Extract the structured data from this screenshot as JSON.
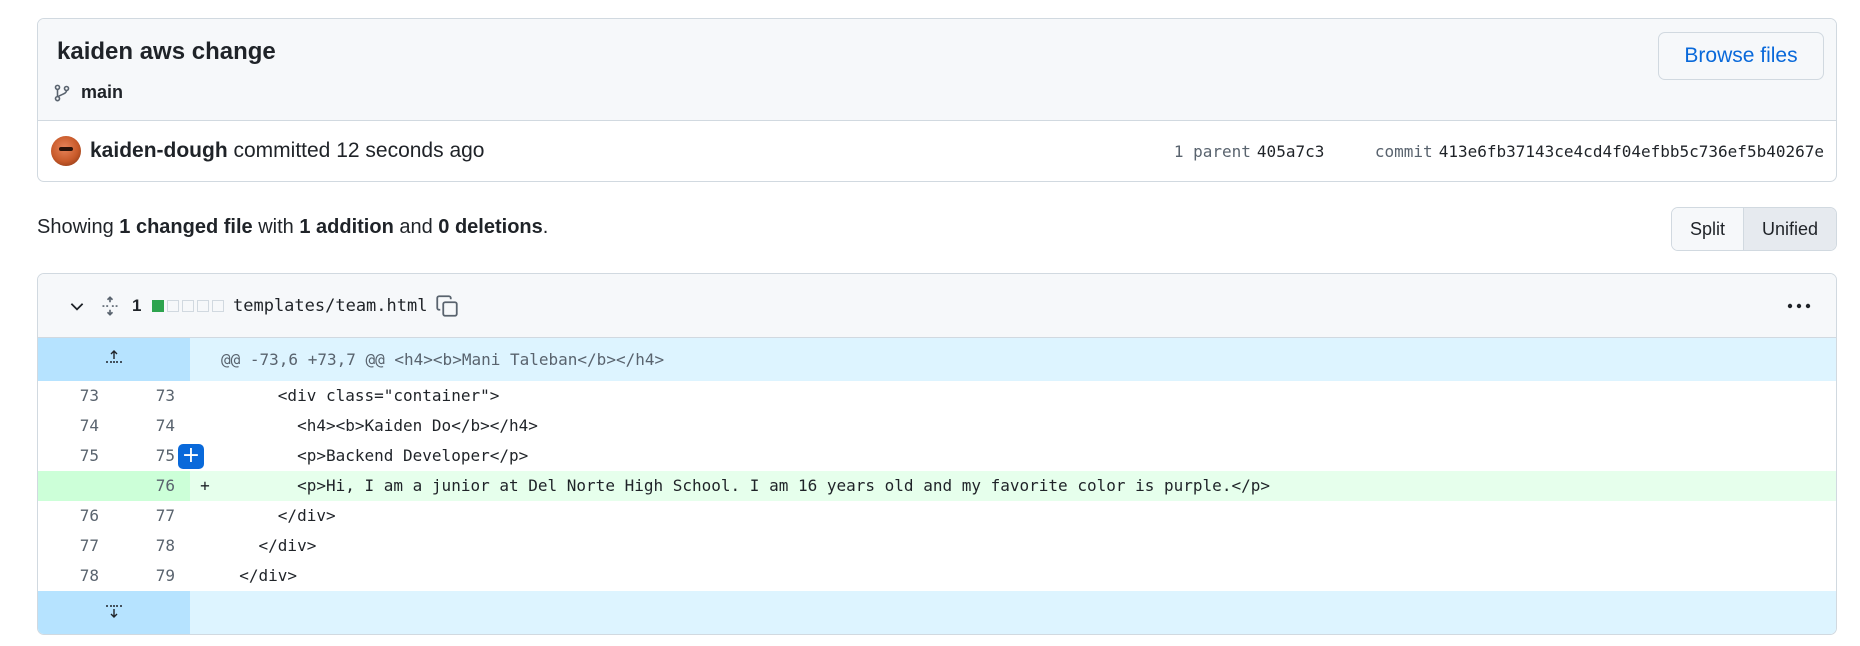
{
  "commit": {
    "title": "kaiden aws change",
    "branch": "main",
    "browse_files_label": "Browse files",
    "author": "kaiden-dough",
    "action": " committed 12 seconds ago",
    "parent_label": "1 parent",
    "parent_sha": "405a7c3",
    "commit_label": "commit",
    "commit_sha": "413e6fb37143ce4cd4f04efbb5c736ef5b40267e"
  },
  "summary": {
    "prefix": "Showing ",
    "changed": "1 changed file",
    "mid1": " with ",
    "additions": "1 addition",
    "mid2": " and ",
    "deletions": "0 deletions",
    "suffix": "."
  },
  "view_toggle": {
    "split": "Split",
    "unified": "Unified",
    "active": "unified"
  },
  "file": {
    "change_count": "1",
    "path": "templates/team.html",
    "diffstat": [
      "add",
      "neutral",
      "neutral",
      "neutral",
      "neutral"
    ],
    "hunk_header": "@@ -73,6 +73,7 @@ <h4><b>Mani Taleban</b></h4>",
    "lines": [
      {
        "old": "73",
        "new": "73",
        "sign": "",
        "type": "context",
        "code": "      <div class=\"container\">"
      },
      {
        "old": "74",
        "new": "74",
        "sign": "",
        "type": "context",
        "code": "        <h4><b>Kaiden Do</b></h4>"
      },
      {
        "old": "75",
        "new": "75",
        "sign": "",
        "type": "context",
        "code": "        <p>Backend Developer</p>"
      },
      {
        "old": "",
        "new": "76",
        "sign": "+",
        "type": "added",
        "code": "        <p>Hi, I am a junior at Del Norte High School. I am 16 years old and my favorite color is purple.</p>"
      },
      {
        "old": "76",
        "new": "77",
        "sign": "",
        "type": "context",
        "code": "      </div>"
      },
      {
        "old": "77",
        "new": "78",
        "sign": "",
        "type": "context",
        "code": "    </div>"
      },
      {
        "old": "78",
        "new": "79",
        "sign": "",
        "type": "context",
        "code": "  </div>"
      }
    ]
  },
  "colors": {
    "link": "#0969da",
    "added_bg": "#e6ffec",
    "added_num_bg": "#ccffd8",
    "hunk_bg": "#ddf4ff",
    "diffstat_add": "#2da44e"
  }
}
